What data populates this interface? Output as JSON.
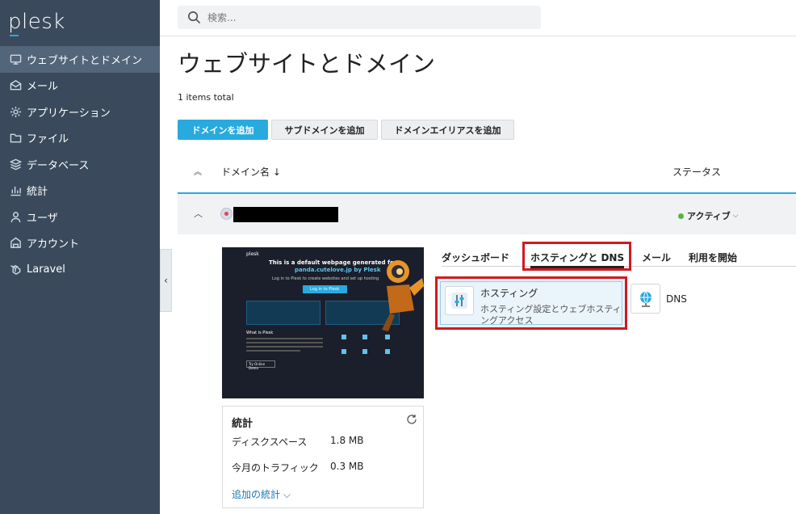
{
  "app": {
    "logo": "plesk"
  },
  "sidebar": {
    "items": [
      {
        "label": "ウェブサイトとドメイン",
        "icon": "monitor-icon",
        "active": true
      },
      {
        "label": "メール",
        "icon": "mail-icon"
      },
      {
        "label": "アプリケーション",
        "icon": "gear-icon"
      },
      {
        "label": "ファイル",
        "icon": "folder-icon"
      },
      {
        "label": "データベース",
        "icon": "database-icon"
      },
      {
        "label": "統計",
        "icon": "bar-chart-icon"
      },
      {
        "label": "ユーザ",
        "icon": "user-icon"
      },
      {
        "label": "アカウント",
        "icon": "account-icon"
      },
      {
        "label": "Laravel",
        "icon": "laravel-icon"
      }
    ],
    "collapse_glyph": "‹"
  },
  "search": {
    "placeholder": "検索..."
  },
  "main": {
    "title": "ウェブサイトとドメイン",
    "items_total": "1 items total",
    "buttons": {
      "add_domain": "ドメインを追加",
      "add_subdomain": "サブドメインを追加",
      "add_alias": "ドメインエイリアスを追加"
    },
    "columns": {
      "domain": "ドメイン名 ↓",
      "status": "ステータス"
    },
    "row": {
      "status": "アクティブ"
    },
    "preview": {
      "brand": "plesk",
      "headline1": "This is a default webpage generated for",
      "headline2": "panda.cutelove.jp by Plesk",
      "sub": "Log in to Plesk to create websites and set up hosting",
      "button": "Log in to Plesk",
      "what": "What is Plesk",
      "demo": "Try Online Demo"
    },
    "stats": {
      "title": "統計",
      "disk_label": "ディスクスペース",
      "disk_value": "1.8 MB",
      "traffic_label": "今月のトラフィック",
      "traffic_value": "0.3 MB",
      "more": "追加の統計 ⌵"
    },
    "tabs": {
      "dashboard": "ダッシュボード",
      "hosting_dns": "ホスティングと DNS",
      "mail": "メール",
      "getting_started": "利用を開始"
    },
    "hosting": {
      "title": "ホスティング",
      "description": "ホスティング設定とウェブホスティングアクセス"
    },
    "dns": {
      "label": "DNS"
    }
  },
  "colors": {
    "accent": "#28aade",
    "sidebar": "#3a4a5c",
    "highlight": "#d2191f",
    "active_status": "#58b33b"
  }
}
